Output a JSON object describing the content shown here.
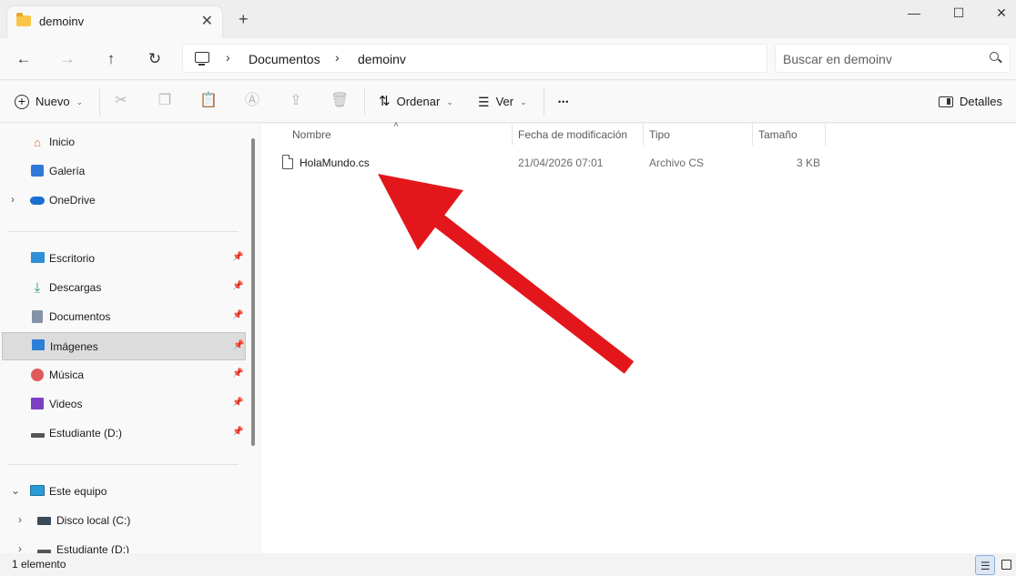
{
  "tab": {
    "title": "demoinv",
    "close_glyph": "✕",
    "new_tab_glyph": "+"
  },
  "window": {
    "minimize_glyph": "—",
    "maximize_glyph": "☐",
    "close_glyph": "✕"
  },
  "address_bar": {
    "breadcrumbs": [
      "Documentos",
      "demoinv"
    ],
    "separator": "›",
    "search_placeholder": "Buscar en demoinv"
  },
  "toolbar": {
    "new_label": "Nuevo",
    "sort_label": "Ordenar",
    "view_label": "Ver",
    "more_glyph": "•••",
    "details_label": "Detalles"
  },
  "sidebar": {
    "top_items": [
      {
        "label": "Inicio",
        "icon": "home-icon"
      },
      {
        "label": "Galería",
        "icon": "gallery-icon"
      },
      {
        "label": "OneDrive",
        "icon": "cloud-icon",
        "expandable": true
      }
    ],
    "quick_access": [
      {
        "label": "Escritorio",
        "icon": "desktop-icon",
        "pinned": true
      },
      {
        "label": "Descargas",
        "icon": "download-icon",
        "pinned": true
      },
      {
        "label": "Documentos",
        "icon": "document-icon",
        "pinned": true
      },
      {
        "label": "Imágenes",
        "icon": "pictures-icon",
        "pinned": true,
        "selected": true
      },
      {
        "label": "Música",
        "icon": "music-icon",
        "pinned": true
      },
      {
        "label": "Videos",
        "icon": "video-icon",
        "pinned": true
      },
      {
        "label": "Estudiante (D:)",
        "icon": "drive-icon",
        "pinned": true
      }
    ],
    "this_pc": {
      "label": "Este equipo",
      "children": [
        {
          "label": "Disco local (C:)"
        },
        {
          "label": "Estudiante (D:)"
        }
      ]
    }
  },
  "file_list": {
    "columns": [
      "Nombre",
      "Fecha de modificación",
      "Tipo",
      "Tamaño"
    ],
    "rows": [
      {
        "name": "HolaMundo.cs",
        "modified": "21/04/2026 07:01",
        "type": "Archivo CS",
        "size": "3 KB"
      }
    ]
  },
  "status": {
    "text": "1 elemento"
  },
  "colors": {
    "arrow": "#e3171b",
    "selection": "#dcdcdc",
    "folder": "#f8c74a"
  }
}
